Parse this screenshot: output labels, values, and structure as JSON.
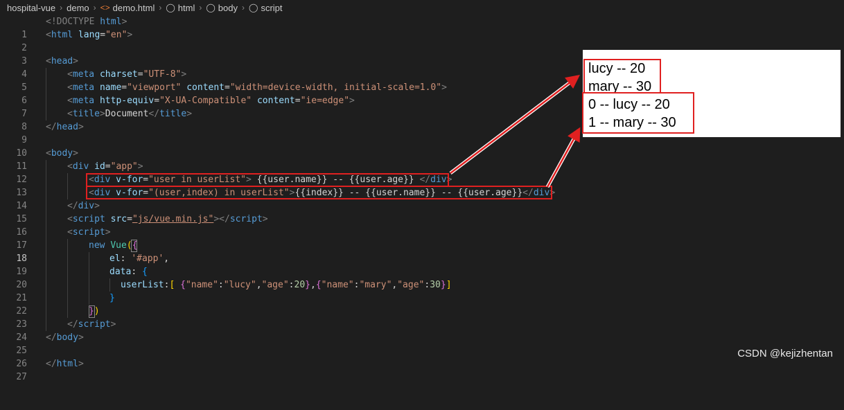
{
  "breadcrumb": {
    "items": [
      "hospital-vue",
      "demo",
      "demo.html",
      "html",
      "body",
      "script"
    ]
  },
  "code": {
    "line_numbers": [
      "1",
      "2",
      "3",
      "4",
      "5",
      "6",
      "7",
      "8",
      "9",
      "10",
      "11",
      "12",
      "13",
      "14",
      "15",
      "16",
      "17",
      "18",
      "19",
      "20",
      "21",
      "22",
      "23",
      "24",
      "25",
      "26",
      "27"
    ],
    "l1": {
      "doctype": "<!DOCTYPE",
      "html": "html"
    },
    "l2": {
      "tag": "html",
      "attr": "lang",
      "value": "\"en\""
    },
    "l4": {
      "tag": "head"
    },
    "l5": {
      "tag": "meta",
      "attr": "charset",
      "value": "\"UTF-8\""
    },
    "l6": {
      "tag": "meta",
      "attr1": "name",
      "value1": "\"viewport\"",
      "attr2": "content",
      "value2": "\"width=device-width, initial-scale=1.0\""
    },
    "l7": {
      "tag": "meta",
      "attr1": "http-equiv",
      "value1": "\"X-UA-Compatible\"",
      "attr2": "content",
      "value2": "\"ie=edge\""
    },
    "l8": {
      "tag": "title",
      "text": "Document"
    },
    "l9": {
      "tag": "head"
    },
    "l11": {
      "tag": "body"
    },
    "l12": {
      "tag": "div",
      "attr": "id",
      "value": "\"app\""
    },
    "l13": {
      "tag": "div",
      "attr": "v-for",
      "value": "\"user in userList\"",
      "text": " {{user.name}} -- {{user.age}} "
    },
    "l14": {
      "tag": "div",
      "attr": "v-for",
      "value": "\"(user,index) in userList\"",
      "text": "{{index}} -- {{user.name}} -- {{user.age}}"
    },
    "l15": {
      "tag": "div"
    },
    "l16": {
      "tag": "script",
      "attr": "src",
      "value": "\"js/vue.min.js\""
    },
    "l17": {
      "tag": "script"
    },
    "l18": {
      "kw": "new",
      "fn": "Vue"
    },
    "l19": {
      "prop": "el",
      "value": "'#app'"
    },
    "l20": {
      "prop": "data"
    },
    "l21": {
      "prop": "userList",
      "k1": "\"name\"",
      "v1": "\"lucy\"",
      "k2": "\"age\"",
      "n1": "20",
      "k3": "\"name\"",
      "v2": "\"mary\"",
      "k4": "\"age\"",
      "n2": "30"
    },
    "l24": {
      "tag": "script"
    },
    "l25": {
      "tag": "body"
    },
    "l27": {
      "tag": "html"
    }
  },
  "preview": {
    "output": [
      "lucy -- 20",
      "mary -- 30",
      "0 -- lucy -- 20",
      "1 -- mary -- 30"
    ]
  },
  "watermark": "CSDN @kejizhentan",
  "colors": {
    "background": "#1e1e1e",
    "highlight_box": "#e02020",
    "arrow": "#e02020",
    "tag_name": "#569cd6",
    "attribute": "#9cdcfe",
    "string": "#ce9178"
  },
  "icons": [
    "chevron-right-icon",
    "html-file-icon",
    "cube-icon"
  ]
}
